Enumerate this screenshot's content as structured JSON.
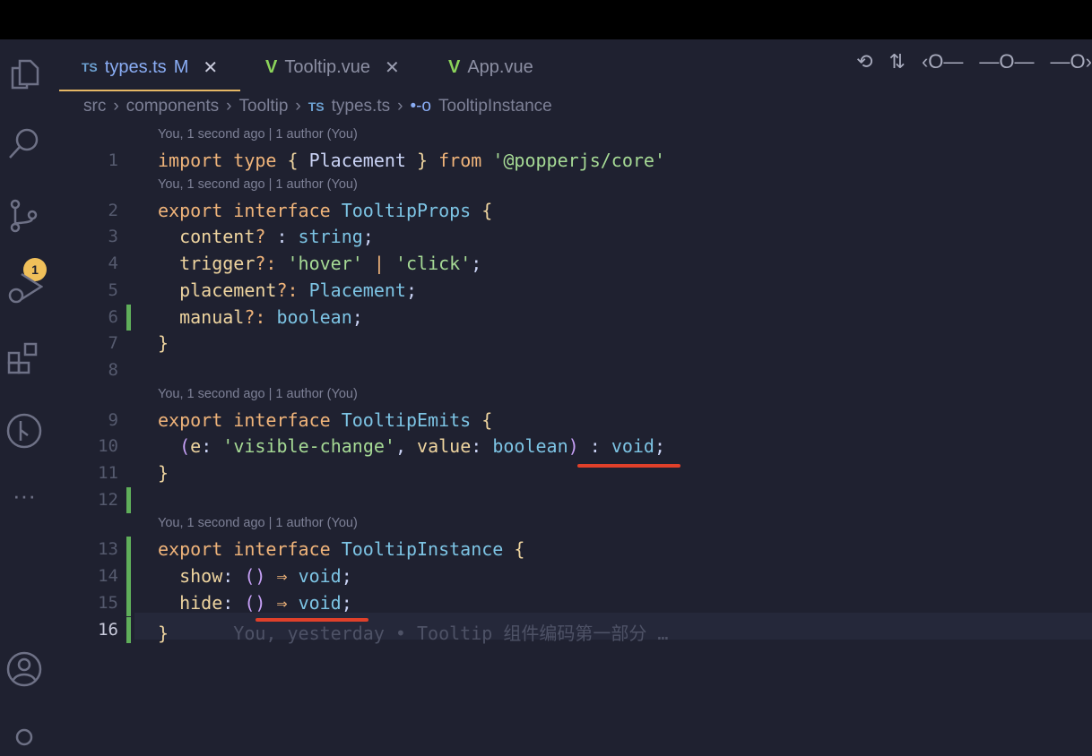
{
  "activity_bar": {
    "scm_badge": "1",
    "icons": [
      "explorer-icon",
      "search-icon",
      "source-control-icon",
      "run-debug-icon",
      "extensions-icon",
      "git-graph-icon",
      "more-icon",
      "account-icon",
      "settings-icon"
    ]
  },
  "tabs": [
    {
      "icon": "TS",
      "label": "types.ts",
      "modified": "M",
      "close": "✕",
      "active": true
    },
    {
      "icon": "V",
      "label": "Tooltip.vue",
      "close": "✕"
    },
    {
      "icon": "V",
      "label": "App.vue"
    }
  ],
  "breadcrumb": {
    "items": [
      "src",
      "components",
      "Tooltip"
    ],
    "file_icon": "TS",
    "file": "types.ts",
    "symbol": "TooltipInstance",
    "separator": "›"
  },
  "editor": {
    "rows": [
      {
        "blame": "You, 1 second ago | 1 author (You)"
      },
      {
        "n": "1",
        "t": [
          [
            "import",
            "kw"
          ],
          [
            " "
          ],
          [
            "type",
            "kw"
          ],
          [
            " "
          ],
          [
            "{",
            "br"
          ],
          [
            " Placement "
          ],
          [
            "}",
            "br"
          ],
          [
            " "
          ],
          [
            "from",
            "kw"
          ],
          [
            " "
          ],
          [
            "'@popperjs/core'",
            "st"
          ]
        ]
      },
      {
        "blame": "You, 1 second ago | 1 author (You)"
      },
      {
        "n": "2",
        "t": [
          [
            "export",
            "kw"
          ],
          [
            " "
          ],
          [
            "interface",
            "kw"
          ],
          [
            " "
          ],
          [
            "TooltipProps",
            "ty"
          ],
          [
            " "
          ],
          [
            "{",
            "br"
          ]
        ]
      },
      {
        "n": "3",
        "t": [
          [
            "  content",
            "pr"
          ],
          [
            "?",
            "op"
          ],
          [
            " : "
          ],
          [
            "string",
            "ty"
          ],
          [
            ";"
          ]
        ]
      },
      {
        "n": "4",
        "t": [
          [
            "  trigger",
            "pr"
          ],
          [
            "?:",
            "op"
          ],
          [
            " "
          ],
          [
            "'hover'",
            "st"
          ],
          [
            " "
          ],
          [
            "|",
            "op"
          ],
          [
            " "
          ],
          [
            "'click'",
            "st"
          ],
          [
            ";"
          ]
        ]
      },
      {
        "n": "5",
        "t": [
          [
            "  placement",
            "pr"
          ],
          [
            "?:",
            "op"
          ],
          [
            " "
          ],
          [
            "Placement",
            "ty"
          ],
          [
            ";"
          ]
        ]
      },
      {
        "n": "6",
        "t": [
          [
            "  manual",
            "pr"
          ],
          [
            "?:",
            "op"
          ],
          [
            " "
          ],
          [
            "boolean",
            "ty"
          ],
          [
            ";"
          ]
        ],
        "git": true
      },
      {
        "n": "7",
        "t": [
          [
            "}",
            "br"
          ]
        ]
      },
      {
        "n": "8",
        "t": []
      },
      {
        "blame": "You, 1 second ago | 1 author (You)"
      },
      {
        "n": "9",
        "t": [
          [
            "export",
            "kw"
          ],
          [
            " "
          ],
          [
            "interface",
            "kw"
          ],
          [
            " "
          ],
          [
            "TooltipEmits",
            "ty"
          ],
          [
            " "
          ],
          [
            "{",
            "br"
          ]
        ]
      },
      {
        "n": "10",
        "t": [
          [
            "  "
          ],
          [
            "(",
            "pa"
          ],
          [
            "e",
            "pr"
          ],
          [
            ": "
          ],
          [
            "'visible-change'",
            "st"
          ],
          [
            ", "
          ],
          [
            "value",
            "pr"
          ],
          [
            ": "
          ],
          [
            "boolean",
            "ty"
          ],
          [
            ")",
            "pa"
          ],
          [
            " : "
          ],
          [
            "void",
            "ty"
          ],
          [
            ";"
          ]
        ]
      },
      {
        "n": "11",
        "t": [
          [
            "}",
            "br"
          ]
        ]
      },
      {
        "n": "12",
        "t": [],
        "git": true
      },
      {
        "blame": "You, 1 second ago | 1 author (You)"
      },
      {
        "n": "13",
        "t": [
          [
            "export",
            "kw"
          ],
          [
            " "
          ],
          [
            "interface",
            "kw"
          ],
          [
            " "
          ],
          [
            "TooltipInstance",
            "ty"
          ],
          [
            " "
          ],
          [
            "{",
            "br"
          ]
        ],
        "git": true
      },
      {
        "n": "14",
        "t": [
          [
            "  show",
            "pr"
          ],
          [
            ": "
          ],
          [
            "()",
            "pa"
          ],
          [
            " ⇒ ",
            "op"
          ],
          [
            "void",
            "ty"
          ],
          [
            ";"
          ]
        ],
        "git": true
      },
      {
        "n": "15",
        "t": [
          [
            "  hide",
            "pr"
          ],
          [
            ": "
          ],
          [
            "()",
            "pa"
          ],
          [
            " ⇒ ",
            "op"
          ],
          [
            "void",
            "ty"
          ],
          [
            ";"
          ]
        ],
        "git": true
      },
      {
        "n": "16",
        "t": [
          [
            "}",
            "br"
          ],
          [
            "      You, yesterday • Tooltip 组件编码第一部分 …",
            "ghost"
          ]
        ],
        "git": true,
        "current": true
      }
    ]
  },
  "colors": {
    "background": "#1f2130",
    "annotation_underline": "#e0402a",
    "git_added": "#5fae5a",
    "active_tab_border": "#e5b765"
  }
}
